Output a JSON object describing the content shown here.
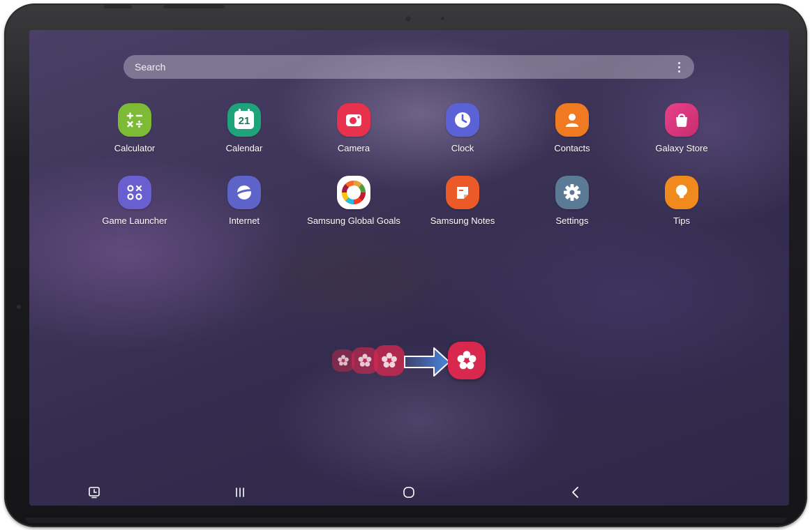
{
  "search": {
    "placeholder": "Search",
    "menu_icon": "more-vert-icon"
  },
  "apps": [
    {
      "label": "Calculator",
      "icon": "calculator-icon",
      "color": "#7dbb36"
    },
    {
      "label": "Calendar",
      "icon": "calendar-icon",
      "color": "#1fa37a",
      "badge": "21"
    },
    {
      "label": "Camera",
      "icon": "camera-icon",
      "color": "#e8314c"
    },
    {
      "label": "Clock",
      "icon": "clock-icon",
      "color": "#5b62d6"
    },
    {
      "label": "Contacts",
      "icon": "contacts-icon",
      "color": "#f07a22"
    },
    {
      "label": "Galaxy Store",
      "icon": "galaxy-store-icon",
      "color": "#e23d7d"
    },
    {
      "label": "Game Launcher",
      "icon": "game-launcher-icon",
      "color": "#6a5fcf"
    },
    {
      "label": "Internet",
      "icon": "internet-icon",
      "color": "#5d63c9"
    },
    {
      "label": "Samsung Global Goals",
      "icon": "global-goals-icon",
      "color": "#ffffff"
    },
    {
      "label": "Samsung Notes",
      "icon": "samsung-notes-icon",
      "color": "#ec5a28"
    },
    {
      "label": "Settings",
      "icon": "settings-icon",
      "color": "#5a7a95"
    },
    {
      "label": "Tips",
      "icon": "tips-icon",
      "color": "#f08a1c"
    }
  ],
  "drag_illustration": {
    "icon": "flower-app-icon",
    "arrow": "arrow-right-icon",
    "color": "#d8284e"
  },
  "navbar": {
    "screenshot": "screenshot-icon",
    "recents": "recent-apps-icon",
    "home": "home-icon",
    "back": "back-icon"
  }
}
